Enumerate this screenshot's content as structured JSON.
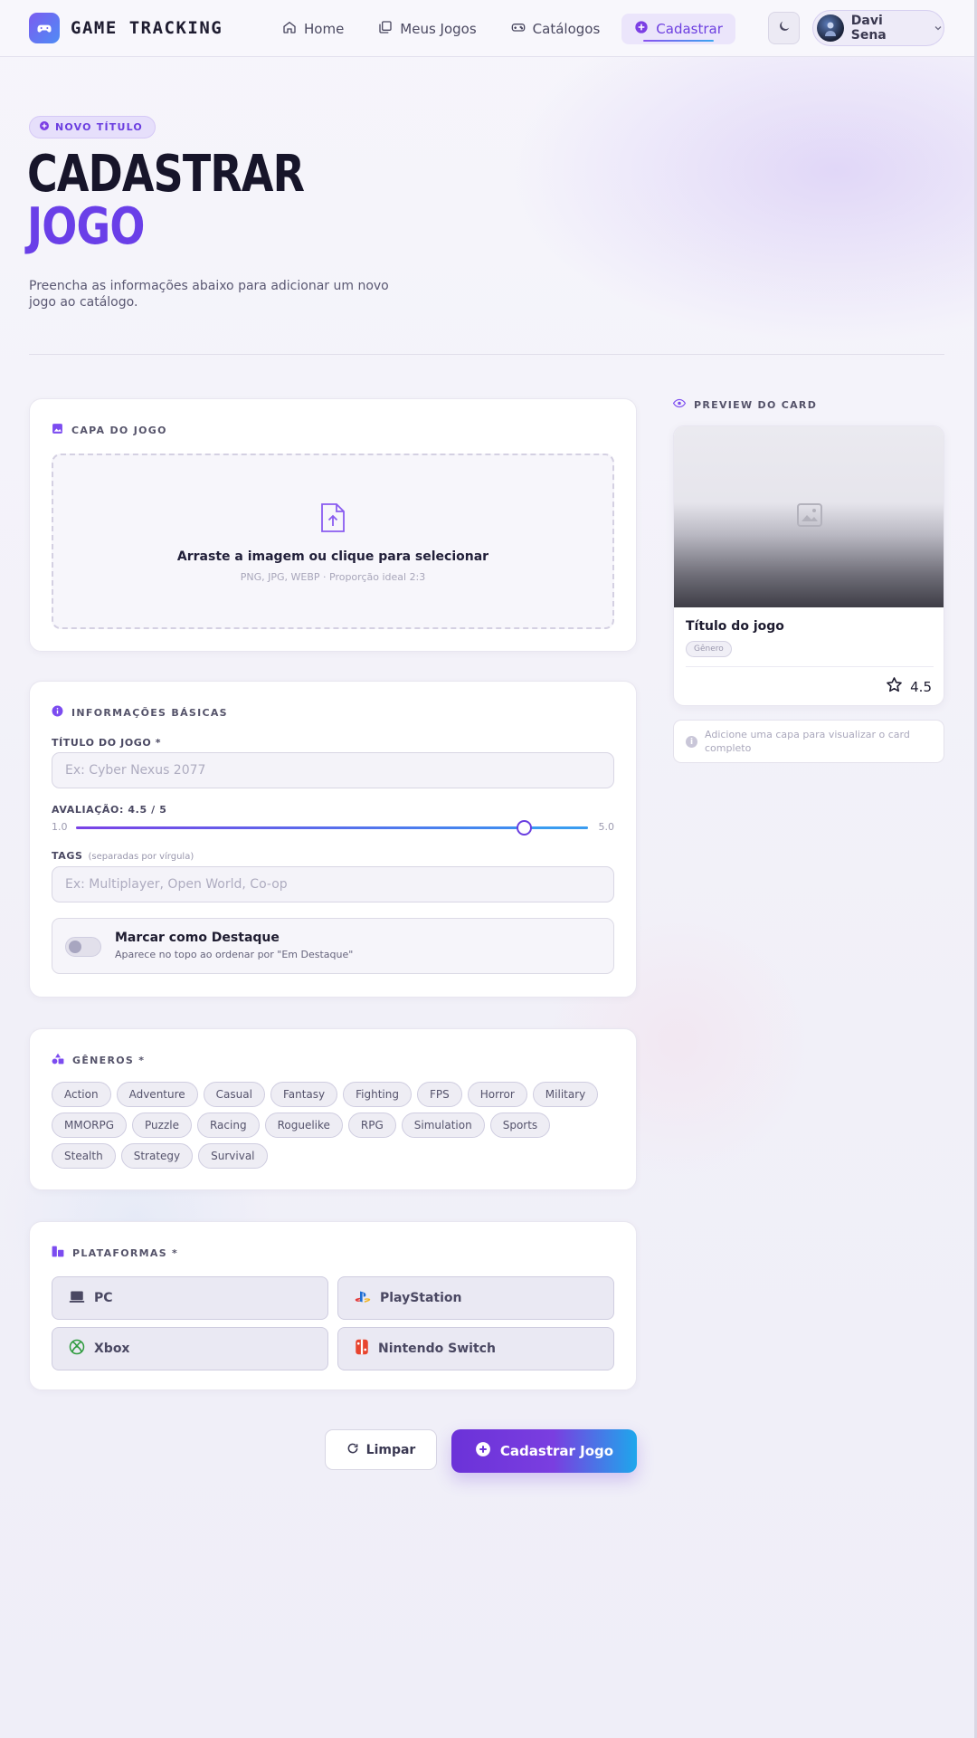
{
  "app": {
    "brand": "GAME TRACKING",
    "accent": "#6a3fe8"
  },
  "nav": {
    "items": [
      {
        "label": "Home",
        "icon": "home-icon"
      },
      {
        "label": "Meus Jogos",
        "icon": "library-icon"
      },
      {
        "label": "Catálogos",
        "icon": "gamepad-icon"
      },
      {
        "label": "Cadastrar",
        "icon": "plus-circle-icon",
        "active": true
      }
    ],
    "theme_toggle_icon": "moon-icon",
    "user": {
      "name": "Davi Sena",
      "icon": "chevron-down-icon"
    }
  },
  "hero": {
    "badge": "NOVO TÍTULO",
    "title_line1": "CADASTRAR",
    "title_line2": "JOGO",
    "description": "Preencha as informações abaixo para adicionar um novo jogo ao catálogo."
  },
  "cover": {
    "section_title": "CAPA DO JOGO",
    "upload_main": "Arraste a imagem ou clique para selecionar",
    "upload_sub": "PNG, JPG, WEBP · Proporção ideal 2:3"
  },
  "basic": {
    "section_title": "INFORMAÇÕES BÁSICAS",
    "title_label": "TÍTULO DO JOGO *",
    "title_placeholder": "Ex: Cyber Nexus 2077",
    "rating_label": "AVALIAÇÃO: 4.5 / 5",
    "rating_min": "1.0",
    "rating_max": "5.0",
    "rating_value": 4.5,
    "rating_min_value": 1.0,
    "rating_max_value": 5.0,
    "tags_label": "TAGS",
    "tags_hint": "(separadas por vírgula)",
    "tags_placeholder": "Ex: Multiplayer, Open World, Co-op",
    "featured_title": "Marcar como Destaque",
    "featured_sub": "Aparece no topo ao ordenar por \"Em Destaque\"",
    "featured_on": false
  },
  "genres": {
    "section_title": "GÊNEROS *",
    "items": [
      "Action",
      "Adventure",
      "Casual",
      "Fantasy",
      "Fighting",
      "FPS",
      "Horror",
      "Military",
      "MMORPG",
      "Puzzle",
      "Racing",
      "Roguelike",
      "RPG",
      "Simulation",
      "Sports",
      "Stealth",
      "Strategy",
      "Survival"
    ]
  },
  "platforms": {
    "section_title": "PLATAFORMAS *",
    "items": [
      {
        "label": "PC",
        "icon": "laptop-icon"
      },
      {
        "label": "PlayStation",
        "icon": "playstation-icon"
      },
      {
        "label": "Xbox",
        "icon": "xbox-icon"
      },
      {
        "label": "Nintendo Switch",
        "icon": "switch-icon"
      }
    ]
  },
  "preview": {
    "section_title": "PREVIEW DO CARD",
    "card_title": "Título do jogo",
    "card_genre": "Gênero",
    "card_rating": "4.5",
    "info": "Adicione uma capa para visualizar o card completo"
  },
  "actions": {
    "clear": "Limpar",
    "submit": "Cadastrar Jogo"
  }
}
